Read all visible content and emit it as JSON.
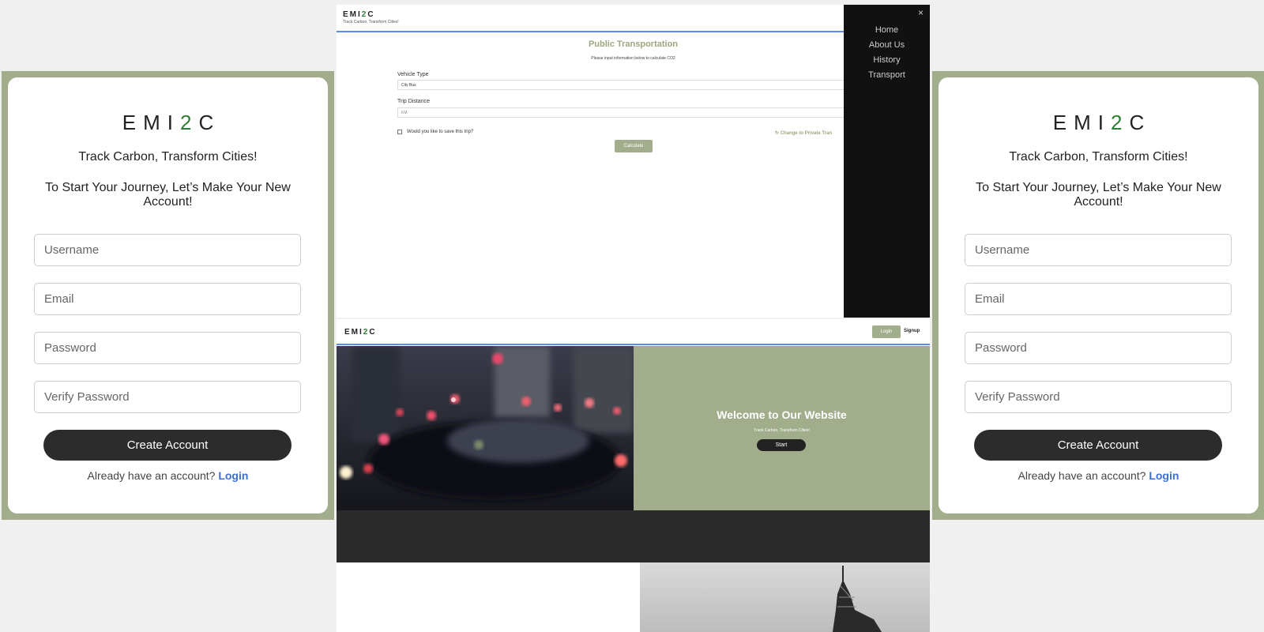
{
  "signup": {
    "logo_prefix": "EMI",
    "logo_accent": "2",
    "logo_suffix": "C",
    "tagline": "Track Carbon, Transform Cities!",
    "prompt": "To Start Your Journey, Let’s Make Your New Account!",
    "username_placeholder": "Username",
    "email_placeholder": "Email",
    "password_placeholder": "Password",
    "verify_placeholder": "Verify Password",
    "create_label": "Create Account",
    "have_account": "Already have an account?",
    "login_link": "Login"
  },
  "transport": {
    "logo_prefix": "EMI",
    "logo_accent": "2",
    "logo_suffix": "C",
    "tagline": "Track Carbon, Transform Cities!",
    "title": "Public Transportation",
    "subtitle": "Please input information below to calculate CO2",
    "vehicle_label": "Vehicle Type",
    "vehicle_value": "City Bus",
    "distance_label": "Trip Distance",
    "distance_placeholder": "KM",
    "save_trip": "Would you like to save this trip?",
    "change_link": "↻ Change to Private Tran",
    "calculate": "Calculate",
    "menu_close": "×",
    "menu": [
      "Home",
      "About Us",
      "History",
      "Transport"
    ]
  },
  "home": {
    "logo_prefix": "EMI",
    "logo_accent": "2",
    "logo_suffix": "C",
    "login": "Login",
    "signup": "Signup",
    "hero_title": "Welcome to Our Website",
    "hero_subtitle": "Track Carbon, Transform Cities!",
    "start": "Start"
  },
  "colors": {
    "brand_green": "#a2ae8b",
    "logo_accent": "#2e7d32",
    "link_blue": "#3b6fd8",
    "dark": "#2c2c2c"
  }
}
